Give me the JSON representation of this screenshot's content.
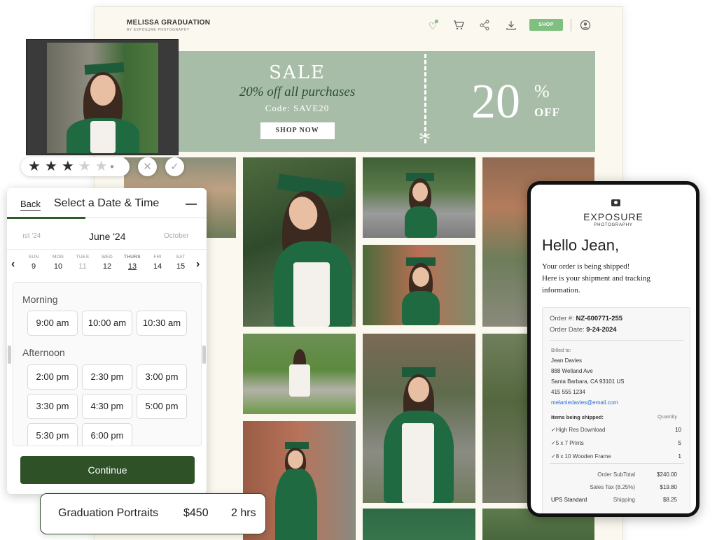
{
  "site": {
    "brand_name": "MELISSA GRADUATION",
    "brand_sub": "BY EXPOSURE PHOTOGRAPHY",
    "icons": [
      "heart-icon",
      "cart-icon",
      "share-icon",
      "download-icon"
    ],
    "shop_label": "SHOP",
    "banner": {
      "title": "SALE",
      "subtitle": "20% off all purchases",
      "code": "Code: SAVE20",
      "button": "SHOP NOW",
      "big_number": "20",
      "percent": "%",
      "off": "OFF"
    }
  },
  "rating": {
    "stars": 3,
    "max": 5
  },
  "scheduler": {
    "back": "Back",
    "title": "Select a Date & Time",
    "prev_month": "ıst '24",
    "current_month": "June '24",
    "next_month": "October",
    "days": [
      {
        "name": "SUN",
        "num": "9",
        "state": "normal"
      },
      {
        "name": "MON",
        "num": "10",
        "state": "normal"
      },
      {
        "name": "TUES",
        "num": "11",
        "state": "muted"
      },
      {
        "name": "WED",
        "num": "12",
        "state": "normal"
      },
      {
        "name": "THURS",
        "num": "13",
        "state": "selected"
      },
      {
        "name": "FRI",
        "num": "14",
        "state": "normal"
      },
      {
        "name": "SAT",
        "num": "15",
        "state": "normal"
      }
    ],
    "morning_label": "Morning",
    "morning": [
      "9:00 am",
      "10:00 am",
      "10:30 am"
    ],
    "afternoon_label": "Afternoon",
    "afternoon": [
      "2:00 pm",
      "2:30 pm",
      "3:00 pm",
      "3:30 pm",
      "4:30 pm",
      "5:00 pm",
      "5:30 pm",
      "6:00 pm"
    ],
    "continue": "Continue"
  },
  "service": {
    "name": "Graduation Portraits",
    "price": "$450",
    "duration": "2 hrs"
  },
  "email": {
    "logo": "EXPOSURE",
    "logo_sub": "PHOTOGRAPHY",
    "greeting": "Hello Jean,",
    "line1": "Your order is being shipped!",
    "line2": "Here is your shipment and tracking",
    "line3": "information.",
    "order_label": "Order #:",
    "order_number": "NZ-600771-255",
    "date_label": "Order Date:",
    "order_date": "9-24-2024",
    "billed_label": "Billed to:",
    "name": "Jean Davies",
    "address1": "888 Welland Ave",
    "address2": "Santa Barbara, CA 93101 US",
    "phone": "415 555 1234",
    "email": "melaniedavies@email.com",
    "items_label": "Items being shipped:",
    "quantity_label": "Quantity",
    "items": [
      {
        "name": "High Res Download",
        "qty": "10"
      },
      {
        "name": "5 x 7 Prints",
        "qty": "5"
      },
      {
        "name": "8 x 10 Wooden Frame",
        "qty": "1"
      }
    ],
    "subtotal_label": "Order SubTotal",
    "subtotal": "$240.00",
    "tax_label": "Sales Tax (8.25%)",
    "tax": "$19.80",
    "carrier": "UPS Standard",
    "shipping_label": "Shipping",
    "shipping": "$8.25"
  }
}
